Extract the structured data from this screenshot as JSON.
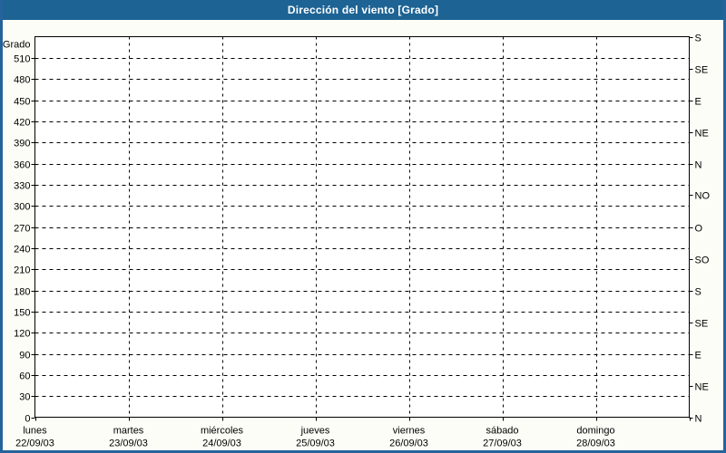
{
  "window": {
    "title": "Dirección del viento [Grado]"
  },
  "colors": {
    "titlebar_bg": "#1D6394",
    "title_text": "#FFFFFF",
    "frame": "#24639B",
    "page_bg": "#FDFDF7",
    "plot_bg": "#FFFFFF",
    "grid_line": "#000000",
    "axis_text": "#000000"
  },
  "chart_data": {
    "type": "line",
    "title": "Dirección del viento [Grado]",
    "ylabel": "Grado",
    "ylim": [
      0,
      540
    ],
    "grid": "dashed",
    "legend": "none",
    "yticks_left": [
      0,
      30,
      60,
      90,
      120,
      150,
      180,
      210,
      240,
      270,
      300,
      330,
      360,
      390,
      420,
      450,
      480,
      510
    ],
    "yticks_right": [
      {
        "value": 0,
        "label": "N"
      },
      {
        "value": 45,
        "label": "NE"
      },
      {
        "value": 90,
        "label": "E"
      },
      {
        "value": 135,
        "label": "SE"
      },
      {
        "value": 180,
        "label": "S"
      },
      {
        "value": 225,
        "label": "SO"
      },
      {
        "value": 270,
        "label": "O"
      },
      {
        "value": 315,
        "label": "NO"
      },
      {
        "value": 360,
        "label": "N"
      },
      {
        "value": 405,
        "label": "NE"
      },
      {
        "value": 450,
        "label": "E"
      },
      {
        "value": 495,
        "label": "SE"
      },
      {
        "value": 540,
        "label": "S"
      }
    ],
    "x_divisions": 7,
    "x_categories": [
      {
        "day": "lunes",
        "date": "22/09/03"
      },
      {
        "day": "martes",
        "date": "23/09/03"
      },
      {
        "day": "miércoles",
        "date": "24/09/03"
      },
      {
        "day": "jueves",
        "date": "25/09/03"
      },
      {
        "day": "viernes",
        "date": "26/09/03"
      },
      {
        "day": "sábado",
        "date": "27/09/03"
      },
      {
        "day": "domingo",
        "date": "28/09/03"
      }
    ],
    "series": []
  }
}
